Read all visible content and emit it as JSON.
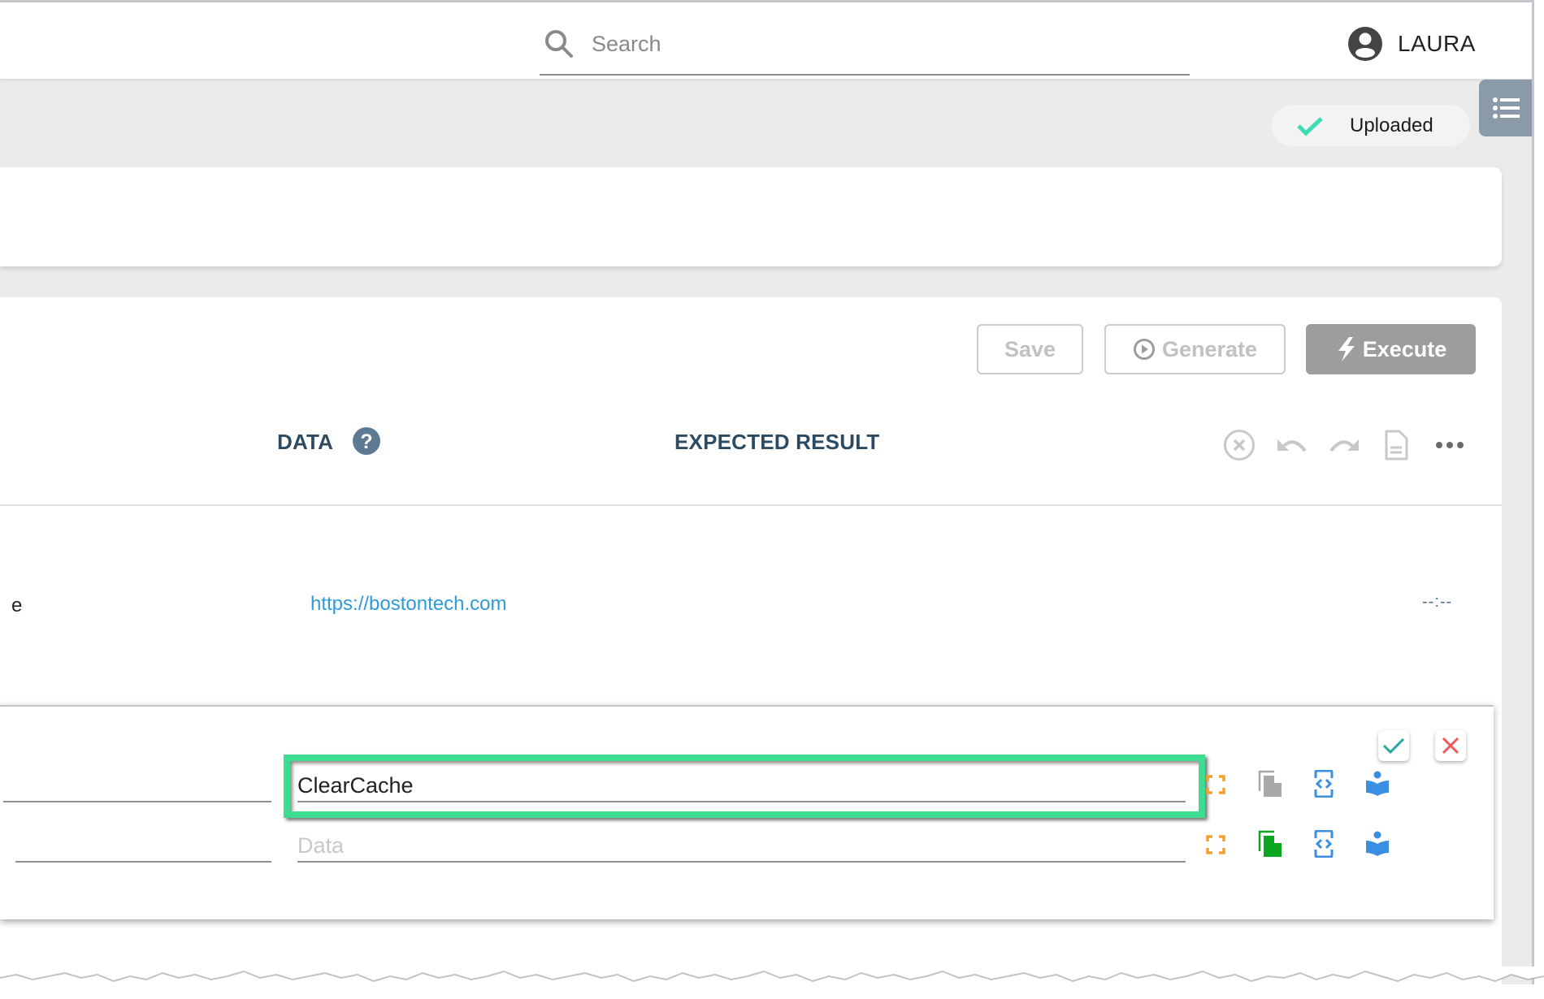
{
  "topbar": {
    "search_placeholder": "Search",
    "search_icon": "search-icon",
    "user_icon": "account-circle-icon",
    "user_name": "LAURA"
  },
  "status": {
    "label": "Uploaded",
    "icon": "check-icon",
    "color": "#3ddcb4"
  },
  "side_menu_icon": "list-icon",
  "toolbar": {
    "save_label": "Save",
    "generate_label": "Generate",
    "generate_icon": "play-circle-icon",
    "execute_label": "Execute",
    "execute_icon": "lightning-icon"
  },
  "table": {
    "columns": [
      {
        "label": "DATA",
        "help_icon": "help-circle-icon"
      },
      {
        "label": "EXPECTED RESULT"
      }
    ],
    "header_actions": [
      "close-circle-icon",
      "undo-icon",
      "redo-icon",
      "document-icon",
      "more-horizontal-icon"
    ],
    "rows": [
      {
        "action_fragment": "e",
        "data": "https://bostontech.com",
        "time": "--:--"
      }
    ]
  },
  "edit_row": {
    "confirm_icon": "check-icon",
    "cancel_icon": "close-icon",
    "fields": [
      {
        "left_value": "",
        "action_value": "ClearCache",
        "action_placeholder": ""
      },
      {
        "left_value": "",
        "data_value": "",
        "data_placeholder": "Data"
      }
    ],
    "row_icons": [
      "expand-icon",
      "copy-icon",
      "code-icon",
      "book-reader-icon"
    ],
    "colors": {
      "highlight": "#3ddc91",
      "expand": "#f5a02f",
      "copy_inactive": "#a8a8a8",
      "copy_active": "#0ca620",
      "code": "#3b8fe0",
      "book": "#3b8fe0",
      "confirm": "#26a8a0",
      "cancel": "#ee5a5a"
    }
  }
}
